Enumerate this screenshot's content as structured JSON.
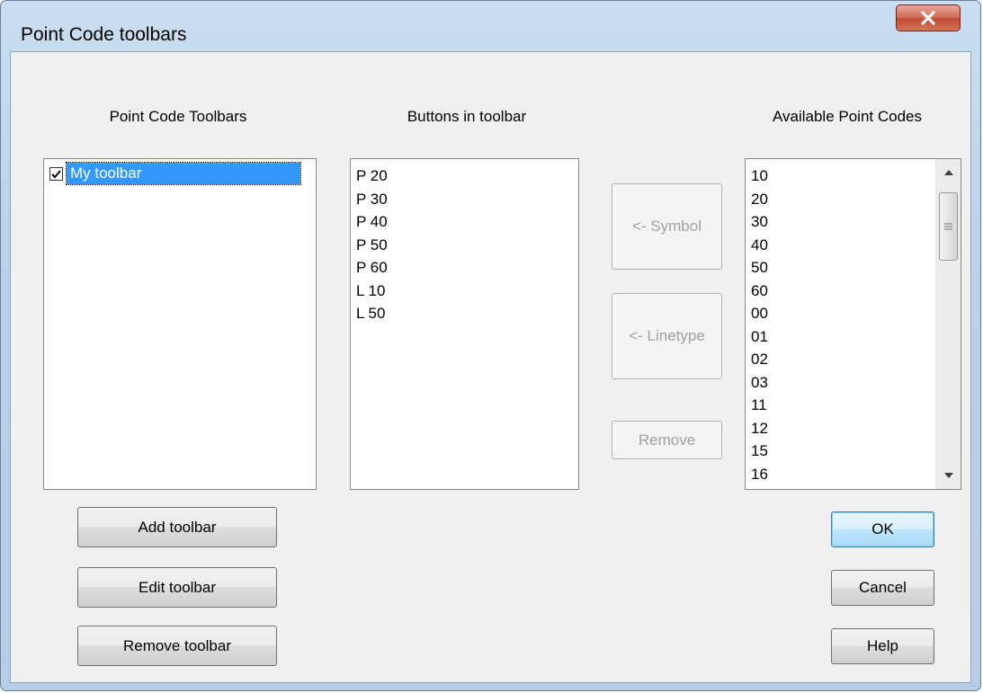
{
  "window": {
    "title": "Point Code toolbars"
  },
  "toolbars_section": {
    "label": "Point Code Toolbars",
    "items": [
      {
        "label": "My toolbar",
        "checked": true,
        "selected": true
      }
    ]
  },
  "buttons_section": {
    "label": "Buttons in toolbar",
    "items": [
      "P 20",
      "P 30",
      "P 40",
      "P 50",
      "P 60",
      "L 10",
      "L 50"
    ]
  },
  "available_section": {
    "label": "Available Point Codes",
    "items": [
      "10",
      "20",
      "30",
      "40",
      "50",
      "60",
      "00",
      "01",
      "02",
      "03",
      "11",
      "12",
      "15",
      "16"
    ]
  },
  "actions": {
    "symbol": "<- Symbol",
    "linetype": "<- Linetype",
    "remove": "Remove"
  },
  "toolbar_actions": {
    "add": "Add toolbar",
    "edit": "Edit toolbar",
    "remove": "Remove toolbar"
  },
  "dialog_buttons": {
    "ok": "OK",
    "cancel": "Cancel",
    "help": "Help"
  }
}
